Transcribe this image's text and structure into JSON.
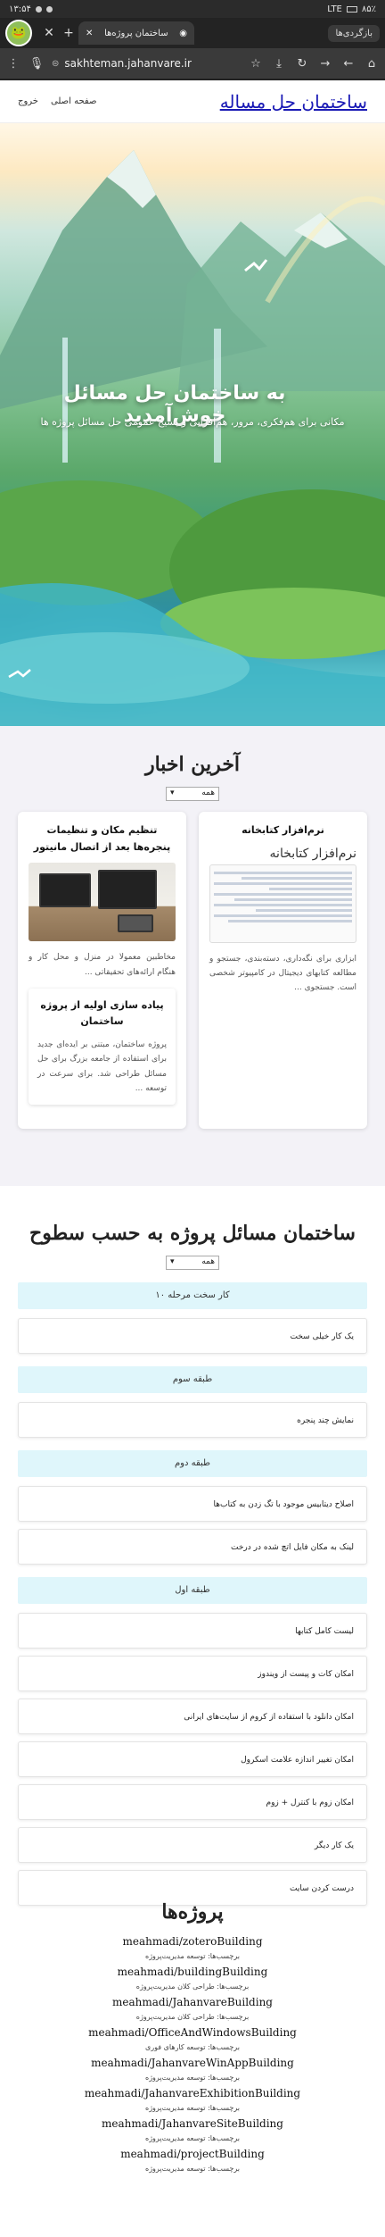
{
  "status_bar": {
    "time": "۱۳:۵۴",
    "battery": "۸۵٪",
    "network": "LTE"
  },
  "browser": {
    "tab_title": "ساختمان پروژه‌ها",
    "tab_groups_label": "بازگردی‌ها",
    "url": "sakhteman.jahanvare.ir",
    "avatar_icon": "frog-avatar-icon"
  },
  "site": {
    "title": "ساختمان حل مساله",
    "nav": [
      "صفحه اصلی",
      "خروج"
    ]
  },
  "hero": {
    "title": "به ساختمان حل مسائل خوش‌آمدید",
    "subtitle": "مکانی برای هم‌فکری، مرور، هم‌افزایی و بسیج عمومی حل مسائل پروژه ها"
  },
  "news": {
    "title": "آخرین اخبار",
    "select_value": "همه",
    "cards": [
      {
        "title": "نرم‌افزار کتابخانه",
        "image_caption": "نرم‌افزار کتابخانه",
        "text": "ابزاری برای نگه‌داری، دسته‌بندی، جستجو و مطالعه کتابهای دیجیتال در کامپیوتر شخصی است. جستجوی ..."
      },
      {
        "title": "تنظیم مکان و تنظیمات پنجره‌ها بعد از اتصال مانیتور",
        "text": "مخاطبین معمولا در منزل و محل کار و هنگام ارائه‌های تحقیقاتی ...",
        "sub_title": "پیاده سازی اولیه از پروژه ساختمان",
        "sub_text": "پروژه ساختمان، مبتنی بر ایده‌ای جدید برای استفاده از جامعه بزرگ برای حل مسائل طراحی شد. برای سرعت در توسعه ..."
      }
    ]
  },
  "levels": {
    "title": "ساختمان مسائل پروژه به حسب سطوح",
    "select_value": "همه",
    "groups": [
      {
        "heading": "کار سخت مرحله ۱۰",
        "items": [
          "یک کار خیلی سخت"
        ]
      },
      {
        "heading": "طبقه سوم",
        "items": [
          "نمایش چند پنجره"
        ]
      },
      {
        "heading": "طبقه دوم",
        "items": [
          "اصلاح دیتابیس موجود با تگ زدن به کتاب‌ها",
          "لینک به مکان فایل اتچ شده در درخت"
        ]
      },
      {
        "heading": "طبقه اول",
        "items": [
          "لیست کامل کتابها",
          "امکان کات و پیست از ویندوز",
          "امکان دانلود با استفاده از کروم از سایت‌های ایرانی",
          "امکان تغییر اندازه علامت اسکرول",
          "امکان زوم با کنترل + زوم",
          "یک کار دیگر",
          "درست کردن سایت"
        ]
      }
    ]
  },
  "projects": {
    "title": "پروژه‌ها",
    "items": [
      {
        "name": "meahmadi/zoteroBuilding",
        "tag": "برچسب‌ها: توسعه مدیریت‌پروژه"
      },
      {
        "name": "meahmadi/buildingBuilding",
        "tag": "برچسب‌ها: طراحی کلان مدیریت‌پروژه"
      },
      {
        "name": "meahmadi/JahanvareBuilding",
        "tag": "برچسب‌ها: طراحی کلان مدیریت‌پروژه"
      },
      {
        "name": "meahmadi/OfficeAndWindowsBuilding",
        "tag": "برچسب‌ها: توسعه کارهای فوری"
      },
      {
        "name": "meahmadi/JahanvareWinAppBuilding",
        "tag": "برچسب‌ها: توسعه مدیریت‌پروژه"
      },
      {
        "name": "meahmadi/JahanvareExhibitionBuilding",
        "tag": "برچسب‌ها: توسعه مدیریت‌پروژه"
      },
      {
        "name": "meahmadi/JahanvareSiteBuilding",
        "tag": "برچسب‌ها: توسعه مدیریت‌پروژه"
      },
      {
        "name": "meahmadi/projectBuilding",
        "tag": "برچسب‌ها: توسعه مدیریت‌پروژه"
      }
    ]
  }
}
